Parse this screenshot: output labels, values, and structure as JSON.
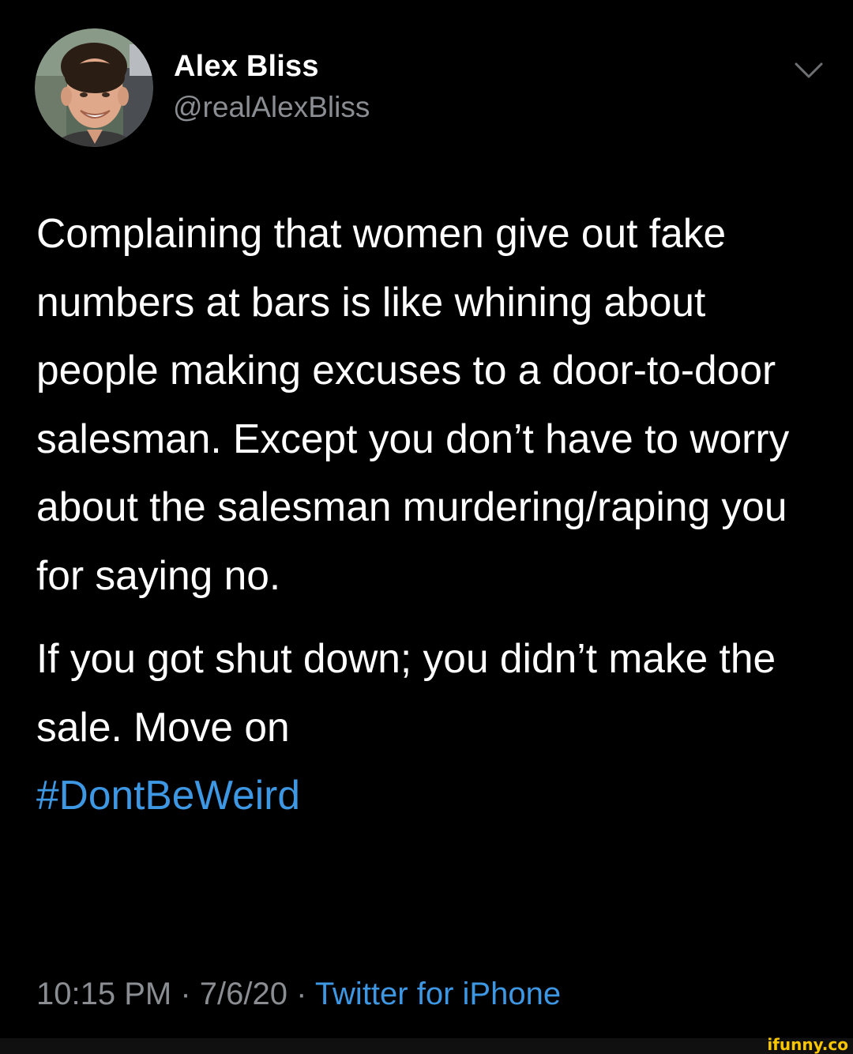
{
  "tweet": {
    "author": {
      "display_name": "Alex Bliss",
      "handle": "@realAlexBliss"
    },
    "menu_icon": "chevron-down-icon",
    "text_paragraph_1": "Complaining that women give out fake numbers at bars is like whining about people making excuses to a door-to-door salesman. Except you don’t have to worry about the salesman murdering/raping you for saying no.",
    "text_paragraph_2": "If you got shut down; you didn’t make the sale. Move on",
    "hashtag": "#DontBeWeird",
    "time": "10:15 PM",
    "separator": " · ",
    "date": "7/6/20",
    "source": "Twitter for iPhone"
  },
  "watermark": {
    "text": "ifunny.co"
  },
  "colors": {
    "background": "#000000",
    "text": "#ffffff",
    "secondary_text": "#8a8d91",
    "link": "#3d97e3",
    "watermark": "#f7c600"
  }
}
